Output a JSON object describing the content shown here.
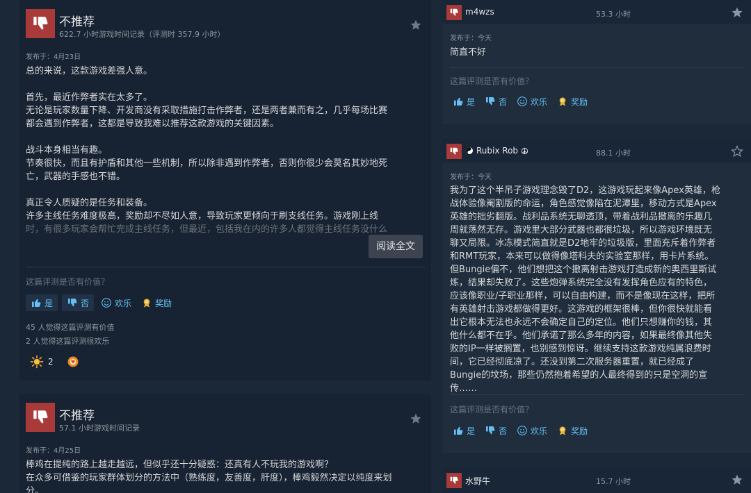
{
  "left_reviews": [
    {
      "verdict": "不推荐",
      "playtime": "622.7 小时游戏时间记录（评测时 357.9 小时）",
      "posted": "发布于：4月23日",
      "body": [
        "总的来说，这款游戏差强人意。",
        "",
        "首先，最近作弊者实在太多了。",
        "无论是玩家数量下降、开发商没有采取措施打击作弊者，还是两者兼而有之，几乎每场比赛",
        "都会遇到作弊者，这都是导致我难以推荐这款游戏的关键因素。",
        "",
        "战斗本身相当有趣。",
        "节奏很快，而且有护盾和其他一些机制，所以除非遇到作弊者，否则你很少会莫名其妙地死",
        "亡，武器的手感也不错。",
        "",
        "真正令人质疑的是任务和装备。",
        "许多主线任务难度极高，奖励却不尽如人意，导致玩家更倾向于刷支线任务。游戏刚上线",
        "时，有很多玩家会帮忙完成主线任务，但最近，包括我在内的许多人都觉得主线任务没什么"
      ],
      "read_more": "阅读全文",
      "question": "这篇评测是否有价值？",
      "votes": {
        "yes": "是",
        "no": "否",
        "funny": "欢乐",
        "award": "奖励"
      },
      "helpful": "45 人觉得这篇评测有价值",
      "funny_count": "2 人觉得这篇评测很欢乐",
      "award_count": "2"
    },
    {
      "verdict": "不推荐",
      "playtime": "57.1 小时游戏时间记录",
      "posted": "发布于：4月25日",
      "body": [
        "棒鸡在提纯的路上越走越远，但似乎还十分疑惑：还真有人不玩我的游戏啊？",
        "在众多可借鉴的玩家群体划分的方法中（熟练度，友善度，肝度），棒鸡毅然决定以纯度来划",
        "分。"
      ]
    }
  ],
  "right_reviews": [
    {
      "name": "m4wzs",
      "hours": "53.3 小时",
      "posted": "发布于：今天",
      "body": [
        "简直不好"
      ],
      "question": "这篇评测是否有价值？",
      "votes": {
        "yes": "是",
        "no": "否",
        "funny": "欢乐",
        "award": "奖励"
      }
    },
    {
      "name": "Rubix Rob",
      "hours": "88.1 小时",
      "posted": "发布于：今天",
      "body": [
        "我为了这个半吊子游戏理念毁了D2，这游戏玩起来像Apex英雄，枪",
        "战体验像阉割版的命运，角色感觉像陷在泥潭里，移动方式是Apex",
        "英雄的拙劣翻版。战利品系统无聊透顶，带着战利品撤离的乐趣几",
        "周就荡然无存。游戏里大部分武器也都很垃圾，所以游戏环境既无",
        "聊又局限。冰冻模式简直就是D2地牢的垃圾版，里面充斥着作弊者",
        "和RMT玩家，本来可以做得像塔科夫的实验室那样，用卡片系统。",
        "但Bungie偏不，他们想把这个撤离射击游戏打造成新的奥西里斯试",
        "炼，结果却失败了。这些炮弹系统完全没有发挥角色应有的特色，",
        "应该像职业/子职业那样，可以自由构建，而不是像现在这样，把所",
        "有英雄射击游戏都做得更好。这游戏的框架很棒，但你很快就能看",
        "出它根本无法也永远不会确定自己的定位。他们只想赚你的钱，其",
        "他什么都不在乎。他们承诺了那么多年的内容，如果最终像其他失",
        "败的IP一样被搁置，也别感到惊讶。继续支持这款游戏纯属浪费时",
        "间，它已经彻底凉了。还没到第二次服务器重置，就已经成了",
        "Bungie的坟场，那些仍然抱着希望的人最终得到的只是空洞的宣",
        "传……"
      ],
      "question": "这篇评测是否有价值？",
      "votes": {
        "yes": "是",
        "no": "否",
        "funny": "欢乐",
        "award": "奖励"
      }
    },
    {
      "name": "水野牛",
      "hours": "15.7 小时"
    }
  ],
  "colors": {
    "thumb_bg": "#a93a3a",
    "link_blue": "#66c0f4",
    "card_bg": "#172232",
    "page_bg": "#1b2838"
  }
}
